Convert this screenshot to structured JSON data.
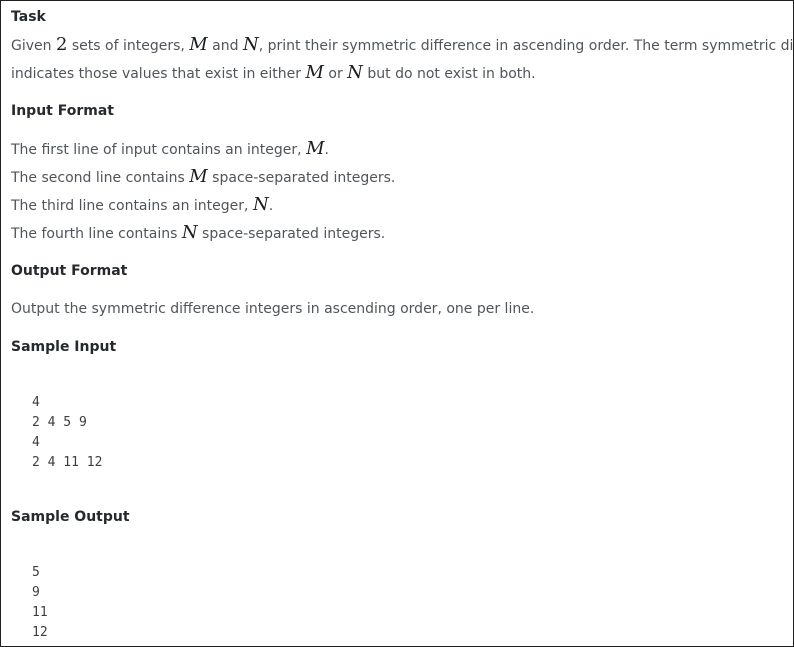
{
  "task": {
    "heading": "Task",
    "line1": {
      "t1": "Given ",
      "n": "2",
      "t2": " sets of integers, ",
      "m": "M",
      "t3": " and ",
      "n2": "N",
      "t4": ", print their symmetric difference in ascending order. The term symmetric difference"
    },
    "line2": {
      "t1": "indicates those values that exist in either ",
      "m": "M",
      "t2": " or ",
      "n": "N",
      "t3": " but do not exist in both."
    }
  },
  "input_format": {
    "heading": "Input Format",
    "lines": [
      {
        "before": "The first line of input contains an integer, ",
        "var": "M",
        "after": "."
      },
      {
        "before": "The second line contains ",
        "var": "M",
        "after": " space-separated integers."
      },
      {
        "before": "The third line contains an integer, ",
        "var": "N",
        "after": "."
      },
      {
        "before": "The fourth line contains ",
        "var": "N",
        "after": " space-separated integers."
      }
    ]
  },
  "output_format": {
    "heading": "Output Format",
    "text": "Output the symmetric difference integers in ascending order, one per line."
  },
  "sample_input": {
    "heading": "Sample Input",
    "lines": [
      "4",
      "2 4 5 9",
      "4",
      "2 4 11 12"
    ]
  },
  "sample_output": {
    "heading": "Sample Output",
    "lines": [
      "5",
      "9",
      "11",
      "12"
    ]
  }
}
